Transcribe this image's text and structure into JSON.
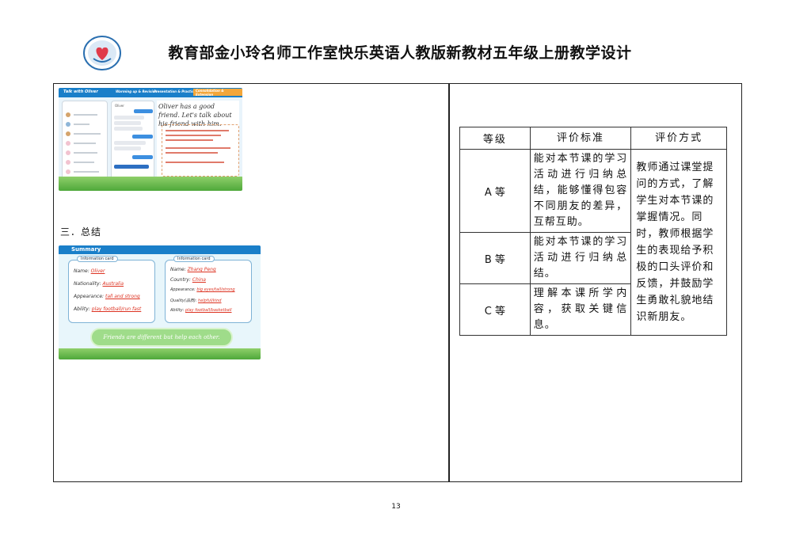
{
  "header": {
    "title": "教育部金小玲名师工作室快乐英语人教版新教材五年级上册教学设计"
  },
  "slide1": {
    "header_label": "Talk with Oliver",
    "tabs": [
      "Warming up & Revision",
      "Presentation & Practice",
      "Consolidation & Extension"
    ],
    "active_tab": "Consolidation & Extension",
    "english_text": "Oliver has a good friend. Let's talk about his friend with him.",
    "contact_name": "Oliver"
  },
  "section": {
    "summary_heading": "三．总结"
  },
  "slide2": {
    "header_label": "Summary",
    "card1": {
      "title": "Information card",
      "fields": [
        {
          "label": "Name:",
          "value": "Oliver"
        },
        {
          "label": "Nationality:",
          "value": "Australia"
        },
        {
          "label": "Appearance:",
          "value": "tall and strong"
        },
        {
          "label": "Ability:",
          "value": "play football/run fast"
        }
      ]
    },
    "card2": {
      "title": "Information card",
      "fields": [
        {
          "label": "Name:",
          "value": "Zhang Peng"
        },
        {
          "label": "Country:",
          "value": "China"
        },
        {
          "label": "Appearance:",
          "value": "big eyes/tall/strong"
        },
        {
          "label": "Quality(品质):",
          "value": "helpful/kind"
        },
        {
          "label": "Ability:",
          "value": "play football/basketball"
        }
      ]
    },
    "banner": "Friends are different but help each other."
  },
  "evaluation": {
    "headers": {
      "grade": "等级",
      "standard": "评价标准",
      "method": "评价方式"
    },
    "rows": [
      {
        "grade": "A 等",
        "standard": "能对本节课的学习活动进行归纳总结，能够懂得包容不同朋友的差异，互帮互助。"
      },
      {
        "grade": "B 等",
        "standard": "能对本节课的学习活动进行归纳总结。"
      },
      {
        "grade": "C 等",
        "standard": "理解本课所学内容，获取关键信息。"
      }
    ],
    "method": "教师通过课堂提问的方式，了解学生对本节课的掌握情况。同时，教师根据学生的表现给予积极的口头评价和反馈，并鼓励学生勇敢礼貌地结识新朋友。"
  },
  "footer": {
    "page_number": "13"
  }
}
